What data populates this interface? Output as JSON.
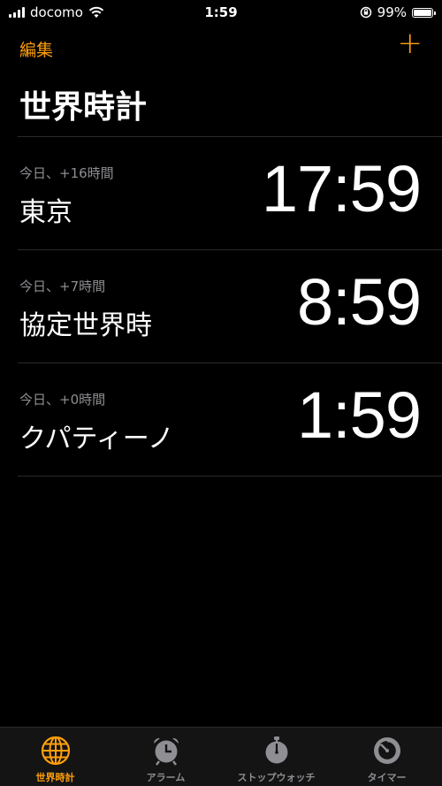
{
  "status": {
    "carrier": "docomo",
    "time": "1:59",
    "battery_percent": "99%",
    "battery_level": 0.99
  },
  "nav": {
    "edit_label": "編集",
    "add_label": "+"
  },
  "title": "世界時計",
  "clocks": [
    {
      "offset": "今日、+16時間",
      "city": "東京",
      "time": "17:59"
    },
    {
      "offset": "今日、+7時間",
      "city": "協定世界時",
      "time": "8:59"
    },
    {
      "offset": "今日、+0時間",
      "city": "クパティーノ",
      "time": "1:59"
    }
  ],
  "tabs": [
    {
      "label": "世界時計",
      "icon": "globe-icon",
      "active": true
    },
    {
      "label": "アラーム",
      "icon": "alarm-clock-icon",
      "active": false
    },
    {
      "label": "ストップウォッチ",
      "icon": "stopwatch-icon",
      "active": false
    },
    {
      "label": "タイマー",
      "icon": "timer-icon",
      "active": false
    }
  ],
  "colors": {
    "accent": "#ff9f0a",
    "background": "#000000",
    "secondary_text": "#8e8e93"
  }
}
